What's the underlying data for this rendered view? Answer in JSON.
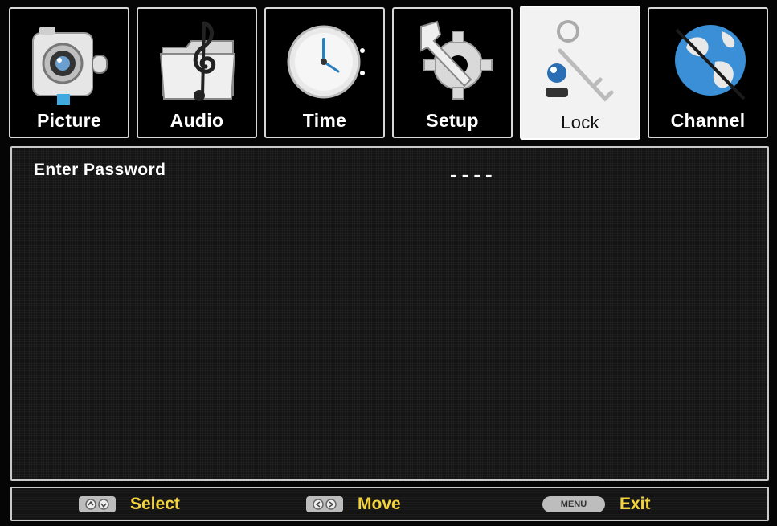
{
  "tabs": [
    {
      "label": "Picture",
      "icon": "camera-icon"
    },
    {
      "label": "Audio",
      "icon": "music-folder-icon"
    },
    {
      "label": "Time",
      "icon": "clock-icon"
    },
    {
      "label": "Setup",
      "icon": "wrench-gear-icon"
    },
    {
      "label": "Lock",
      "icon": "key-icon"
    },
    {
      "label": "Channel",
      "icon": "globe-icon"
    }
  ],
  "active_tab": "Lock",
  "panel": {
    "password_label": "Enter Password",
    "password_value": "----"
  },
  "footer": {
    "select_label": "Select",
    "move_label": "Move",
    "menu_key": "MENU",
    "exit_label": "Exit"
  },
  "colors": {
    "hint_text": "#f4d23b",
    "border": "#c9c9c9",
    "active_tab_bg": "#f2f2f2"
  }
}
